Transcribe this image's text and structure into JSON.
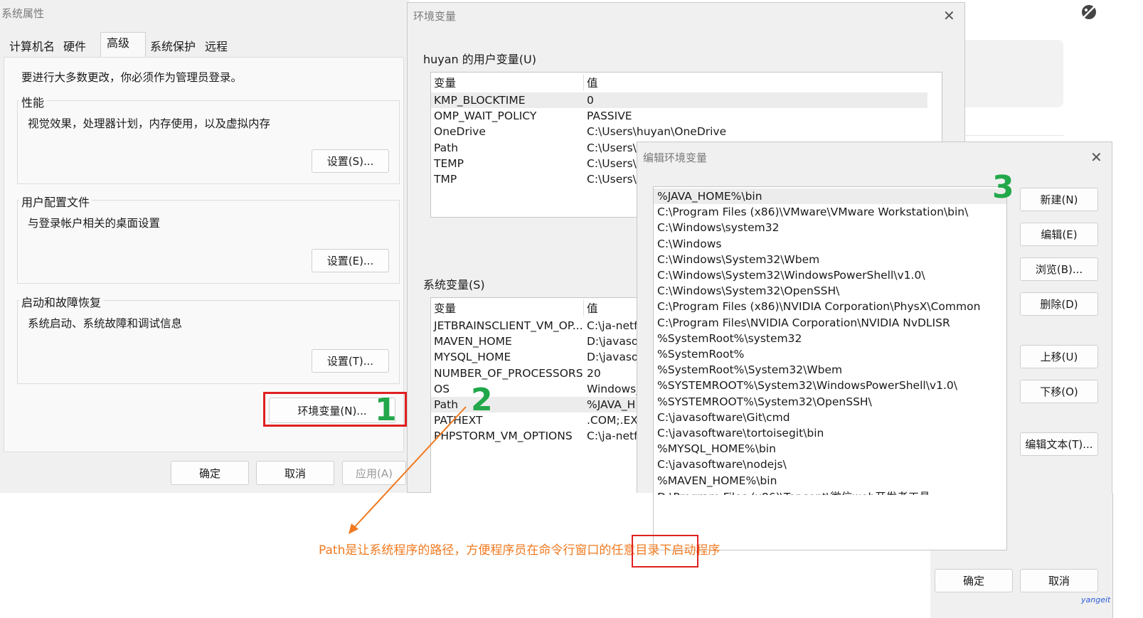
{
  "sysprops": {
    "title": "系统属性",
    "tabs": [
      "计算机名",
      "硬件",
      "高级",
      "系统保护",
      "远程"
    ],
    "notice": "要进行大多数更改，你必须作为管理员登录。",
    "performance": {
      "label": "性能",
      "desc": "视觉效果，处理器计划，内存使用，以及虚拟内存",
      "button": "设置(S)..."
    },
    "profile": {
      "label": "用户配置文件",
      "desc": "与登录帐户相关的桌面设置",
      "button": "设置(E)..."
    },
    "startup": {
      "label": "启动和故障恢复",
      "desc": "系统启动、系统故障和调试信息",
      "button": "设置(T)..."
    },
    "env_button": "环境变量(N)...",
    "ok": "确定",
    "cancel": "取消",
    "apply": "应用(A)"
  },
  "envvars": {
    "title": "环境变量",
    "user_label": "huyan 的用户变量(U)",
    "col_var": "变量",
    "col_val": "值",
    "user_rows": [
      {
        "name": "KMP_BLOCKTIME",
        "value": "0"
      },
      {
        "name": "OMP_WAIT_POLICY",
        "value": "PASSIVE"
      },
      {
        "name": "OneDrive",
        "value": "C:\\Users\\huyan\\OneDrive"
      },
      {
        "name": "Path",
        "value": "C:\\Users\\huyan\\AppData\\Local\\Microsoft\\WindowsApps;C:\\Us..."
      },
      {
        "name": "TEMP",
        "value": "C:\\Users\\h"
      },
      {
        "name": "TMP",
        "value": "C:\\Users\\h"
      }
    ],
    "sys_label": "系统变量(S)",
    "sys_rows": [
      {
        "name": "JETBRAINSCLIENT_VM_OP...",
        "value": "C:\\ja-netfi"
      },
      {
        "name": "MAVEN_HOME",
        "value": "D:\\javasof"
      },
      {
        "name": "MYSQL_HOME",
        "value": "D:\\javasof"
      },
      {
        "name": "NUMBER_OF_PROCESSORS",
        "value": "20"
      },
      {
        "name": "OS",
        "value": "Windows_"
      },
      {
        "name": "Path",
        "value": "%JAVA_H"
      },
      {
        "name": "PATHEXT",
        "value": ".COM;.EXE"
      },
      {
        "name": "PHPSTORM_VM_OPTIONS",
        "value": "C:\\ja-netfi"
      }
    ]
  },
  "editenv": {
    "title": "编辑环境变量",
    "entries": [
      "%JAVA_HOME%\\bin",
      "C:\\Program Files (x86)\\VMware\\VMware Workstation\\bin\\",
      "C:\\Windows\\system32",
      "C:\\Windows",
      "C:\\Windows\\System32\\Wbem",
      "C:\\Windows\\System32\\WindowsPowerShell\\v1.0\\",
      "C:\\Windows\\System32\\OpenSSH\\",
      "C:\\Program Files (x86)\\NVIDIA Corporation\\PhysX\\Common",
      "C:\\Program Files\\NVIDIA Corporation\\NVIDIA NvDLISR",
      "%SystemRoot%\\system32",
      "%SystemRoot%",
      "%SystemRoot%\\System32\\Wbem",
      "%SYSTEMROOT%\\System32\\WindowsPowerShell\\v1.0\\",
      "%SYSTEMROOT%\\System32\\OpenSSH\\",
      "C:\\javasoftware\\Git\\cmd",
      "C:\\javasoftware\\tortoisegit\\bin",
      "%MYSQL_HOME%\\bin",
      "C:\\javasoftware\\nodejs\\",
      "%MAVEN_HOME%\\bin"
    ],
    "btn_new": "新建(N)",
    "btn_edit": "编辑(E)",
    "btn_browse": "浏览(B)...",
    "btn_delete": "删除(D)",
    "btn_up": "上移(U)",
    "btn_down": "下移(O)",
    "btn_edittext": "编辑文本(T)...",
    "ok": "确定",
    "cancel": "取消"
  },
  "annotations": {
    "step1": "1",
    "step2": "2",
    "step3": "3",
    "note": "Path是让系统程序的路径，方便程序员在命令行窗口的任意目录下启动程序",
    "watermark": "yangeit",
    "colors": {
      "highlight": "#e02020",
      "step": "#22a84a",
      "arrow": "#f07a20"
    }
  }
}
